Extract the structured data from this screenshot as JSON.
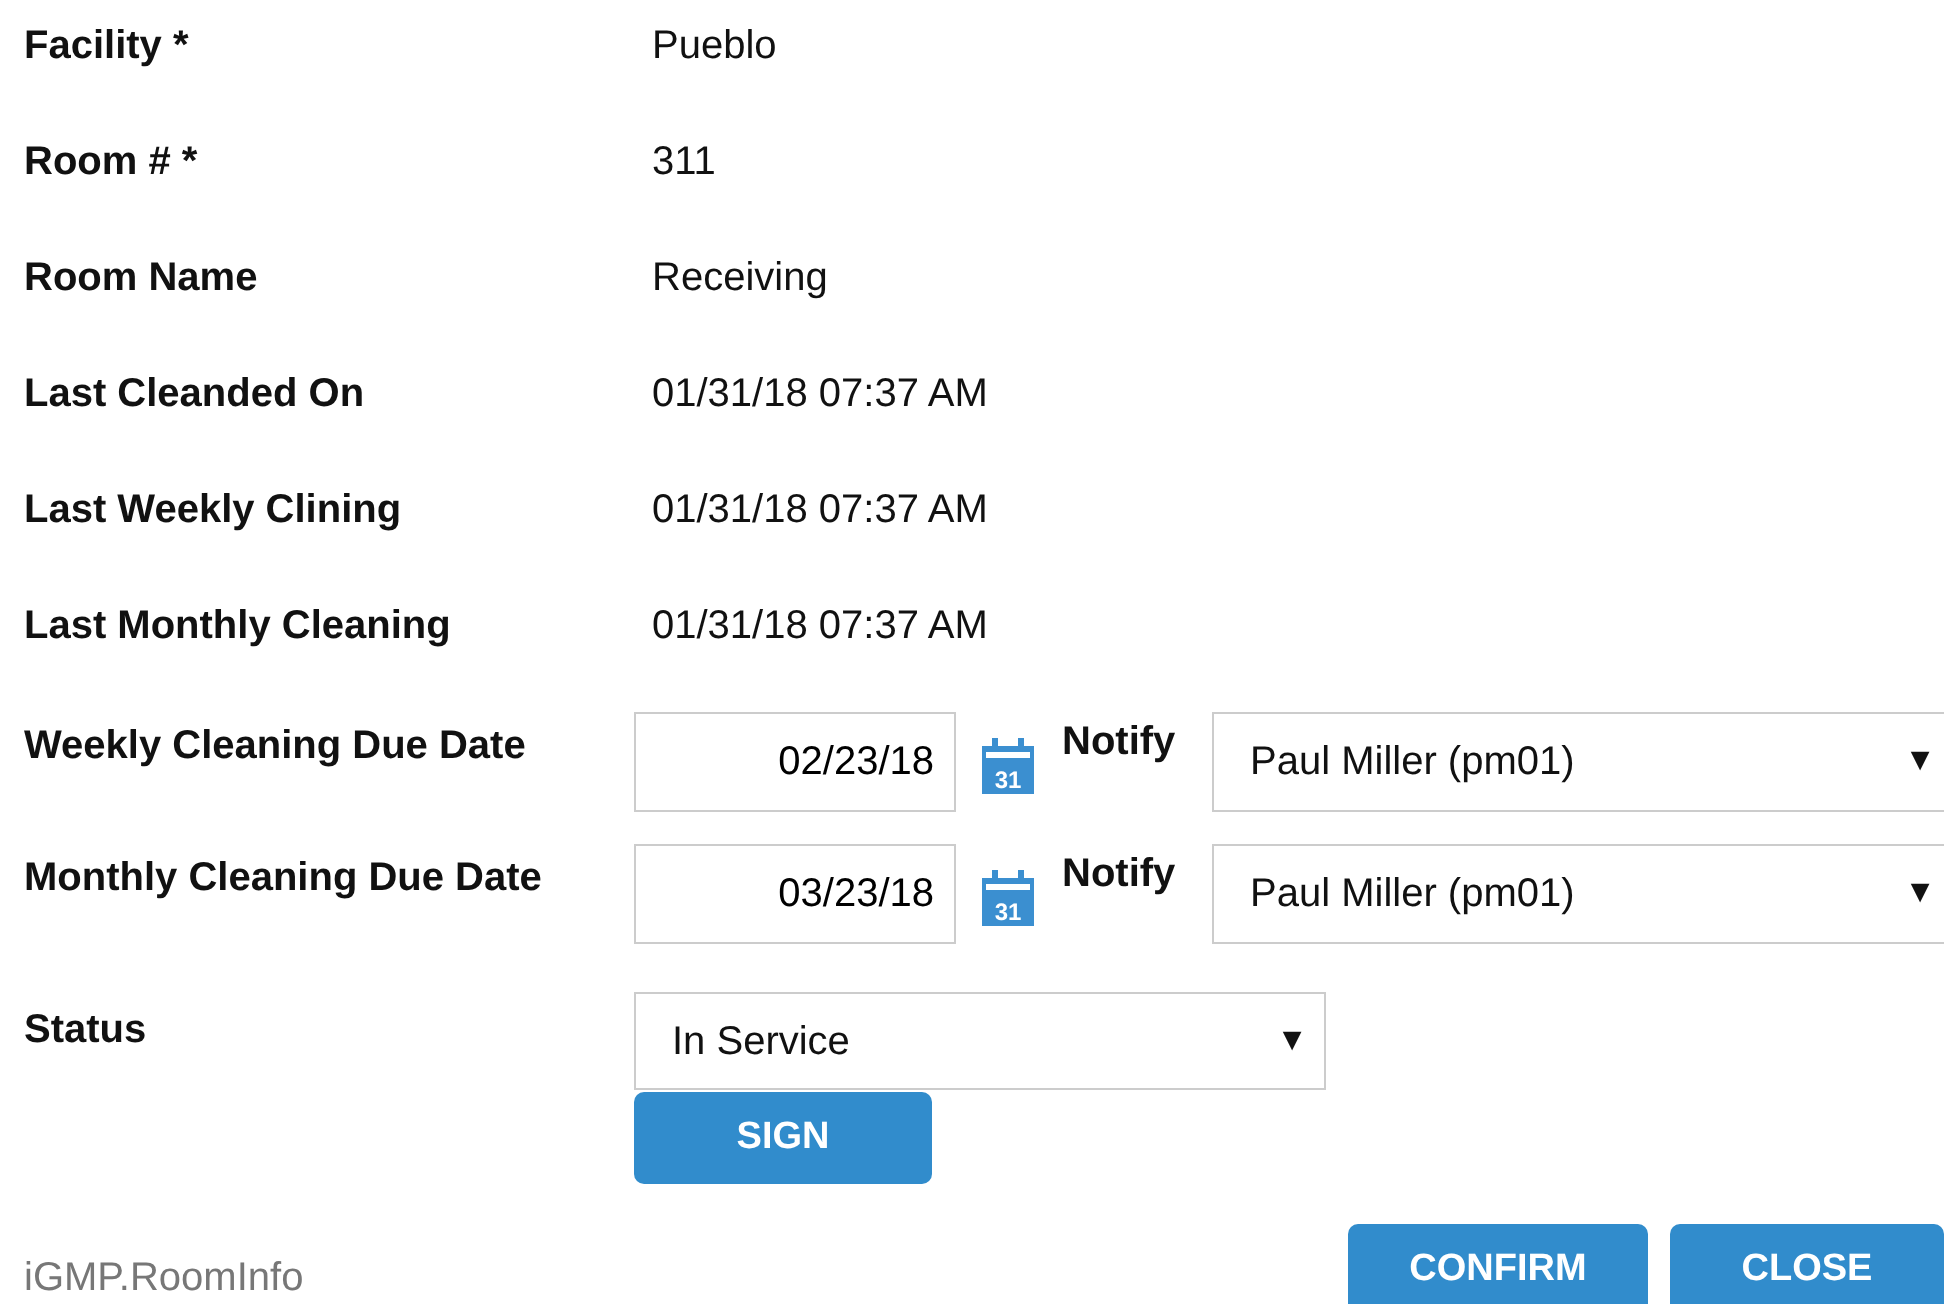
{
  "info_rows": [
    {
      "label": "Facility *",
      "value": "Pueblo"
    },
    {
      "label": "Room # *",
      "value": "311"
    },
    {
      "label": "Room Name",
      "value": "Receiving"
    },
    {
      "label": "Last Cleanded On",
      "value": "01/31/18 07:37 AM"
    },
    {
      "label": "Last Weekly Clining",
      "value": "01/31/18 07:37 AM"
    },
    {
      "label": "Last Monthly Cleaning",
      "value": "01/31/18 07:37 AM"
    }
  ],
  "due_rows": [
    {
      "label": "Weekly Cleaning Due Date",
      "date": "02/23/18",
      "calendar_day": "31",
      "notify_label": "Notify",
      "notify_value": "Paul Miller (pm01)",
      "caret": "▼"
    },
    {
      "label": "Monthly Cleaning Due Date",
      "date": "03/23/18",
      "calendar_day": "31",
      "notify_label": "Notify",
      "notify_value": "Paul Miller (pm01)",
      "caret": "▼"
    }
  ],
  "status": {
    "label": "Status",
    "value": "In Service",
    "caret": "▼"
  },
  "sign_button": "SIGN",
  "footer": {
    "form_id": "iGMP.RoomInfo",
    "buttons": [
      "CONFIRM",
      "CLOSE"
    ]
  }
}
